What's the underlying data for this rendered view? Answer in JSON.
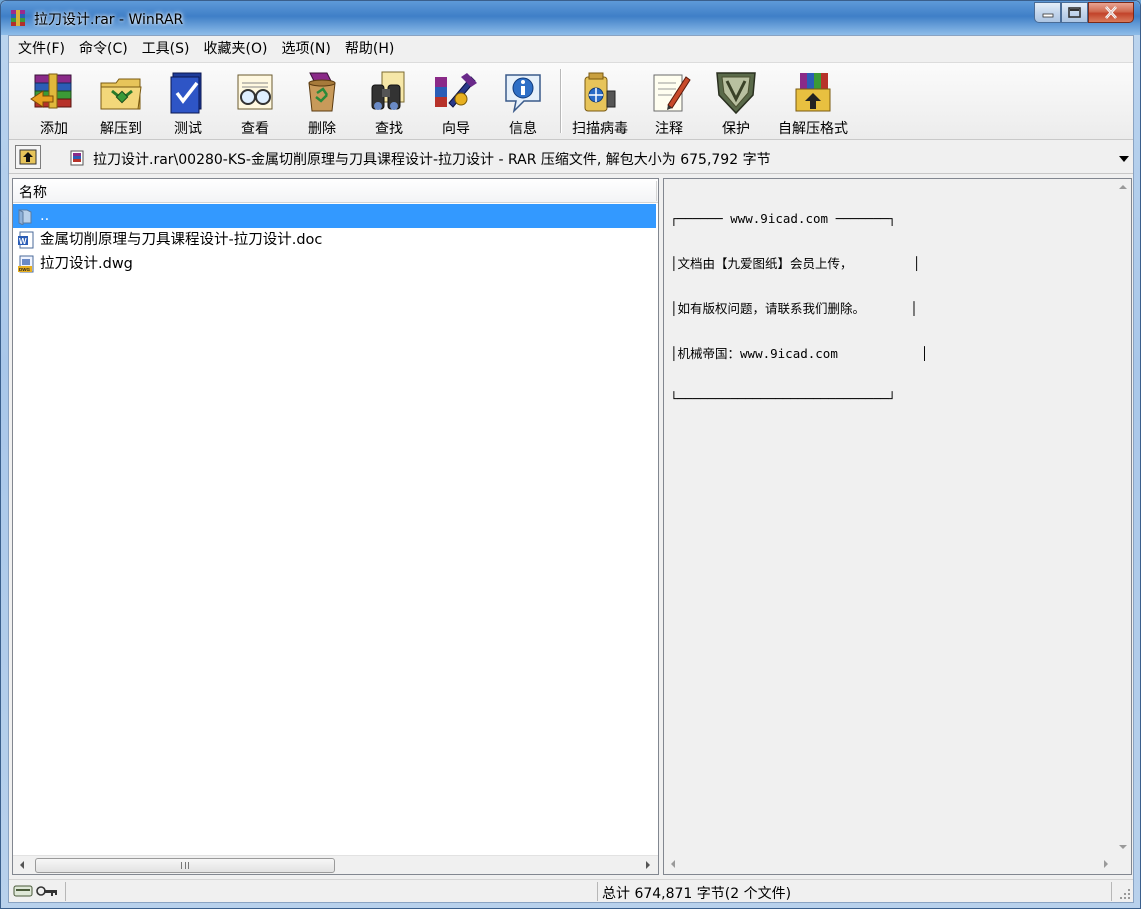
{
  "window": {
    "title": "拉刀设计.rar - WinRAR"
  },
  "menu": [
    {
      "label": "文件(F)"
    },
    {
      "label": "命令(C)"
    },
    {
      "label": "工具(S)"
    },
    {
      "label": "收藏夹(O)"
    },
    {
      "label": "选项(N)"
    },
    {
      "label": "帮助(H)"
    }
  ],
  "toolbar": {
    "add": "添加",
    "extract": "解压到",
    "test": "测试",
    "view": "查看",
    "delete": "删除",
    "find": "查找",
    "wizard": "向导",
    "info": "信息",
    "virus_scan": "扫描病毒",
    "comment": "注释",
    "protect": "保护",
    "sfx": "自解压格式"
  },
  "address": {
    "path": "拉刀设计.rar\\00280-KS-金属切削原理与刀具课程设计-拉刀设计 - RAR 压缩文件, 解包大小为 675,792 字节"
  },
  "file_list": {
    "column_name": "名称",
    "rows": [
      {
        "name": "..",
        "icon": "folder-up-icon",
        "selected": true
      },
      {
        "name": "金属切削原理与刀具课程设计-拉刀设计.doc",
        "icon": "word-doc-icon",
        "selected": false
      },
      {
        "name": "拉刀设计.dwg",
        "icon": "dwg-file-icon",
        "selected": false
      }
    ]
  },
  "comment": {
    "lines": [
      "┌────── www.9icad.com ───────┐",
      "│文档由【九爱图纸】会员上传，        │",
      "│如有版权问题，请联系我们删除。      │",
      "│机械帝国：www.9icad.com           │",
      "└────────────────────────────┘"
    ]
  },
  "status": {
    "total": "总计 674,871 字节(2 个文件)"
  },
  "colors": {
    "selection": "#3399ff",
    "titlebar": "#5e9ad9",
    "close_button": "#c2432a"
  }
}
